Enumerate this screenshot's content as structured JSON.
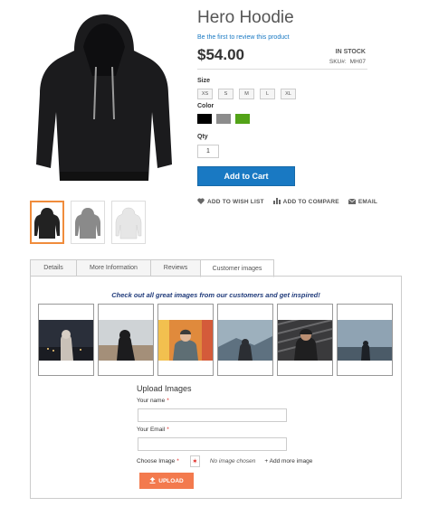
{
  "product": {
    "title": "Hero Hoodie",
    "review_link": "Be the first to review this product",
    "price": "$54.00",
    "stock": "IN STOCK",
    "sku_label": "SKU#:",
    "sku_value": "MH07"
  },
  "options": {
    "size_label": "Size",
    "sizes": [
      "XS",
      "S",
      "M",
      "L",
      "XL"
    ],
    "color_label": "Color",
    "colors": [
      "#000000",
      "#8c8c8c",
      "#53a318"
    ],
    "qty_label": "Qty",
    "qty_value": "1"
  },
  "cart": {
    "add_to_cart": "Add to Cart"
  },
  "actions": {
    "wishlist": "ADD TO WISH LIST",
    "compare": "ADD TO COMPARE",
    "email": "EMAIL"
  },
  "tabs": [
    "Details",
    "More Information",
    "Reviews",
    "Customer images"
  ],
  "customer_images": {
    "heading": "Check out all great images from our customers and get inspired!",
    "upload_title": "Upload Images",
    "name_label": "Your name",
    "email_label": "Your Email",
    "choose_label": "Choose Image",
    "no_image": "No image chosen",
    "add_more": "+ Add more image",
    "upload_button": "UPLOAD"
  },
  "colors": {
    "primary": "#1979c3",
    "upload": "#f37a4e",
    "active_thumb": "#f08c3c",
    "required": "#e02b27"
  }
}
